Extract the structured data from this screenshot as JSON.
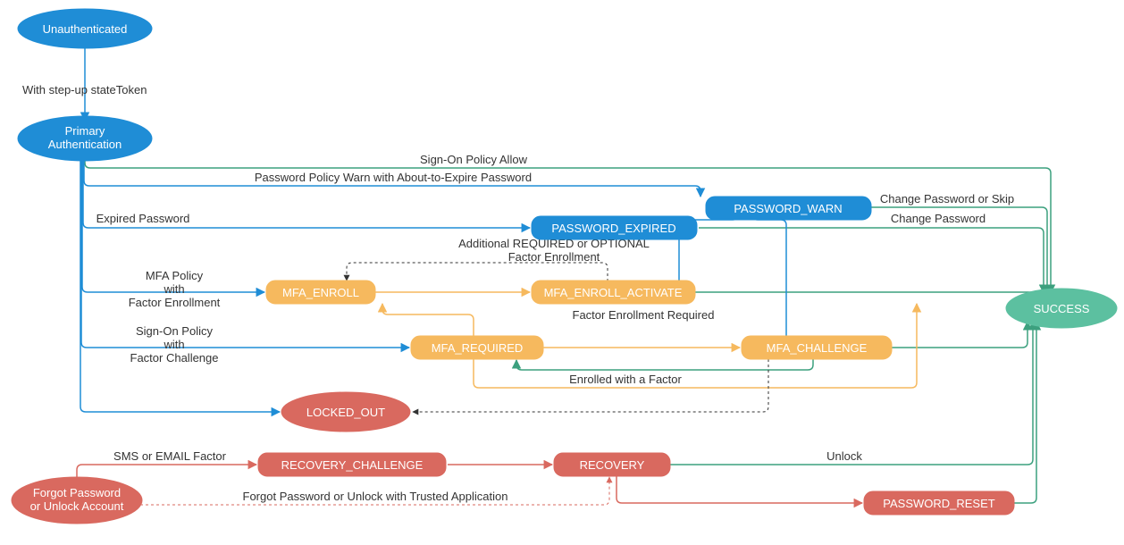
{
  "diagram": {
    "nodes": {
      "unauthenticated": "Unauthenticated",
      "primary_auth_l1": "Primary",
      "primary_auth_l2": "Authentication",
      "password_warn": "PASSWORD_WARN",
      "password_expired": "PASSWORD_EXPIRED",
      "mfa_enroll": "MFA_ENROLL",
      "mfa_enroll_activate": "MFA_ENROLL_ACTIVATE",
      "mfa_required": "MFA_REQUIRED",
      "mfa_challenge": "MFA_CHALLENGE",
      "locked_out": "LOCKED_OUT",
      "recovery_challenge": "RECOVERY_CHALLENGE",
      "recovery": "RECOVERY",
      "password_reset": "PASSWORD_RESET",
      "success": "SUCCESS",
      "forgot_l1": "Forgot Password",
      "forgot_l2": "or Unlock Account"
    },
    "edges": {
      "step_up": "With step-up stateToken",
      "signon_allow": "Sign-On Policy Allow",
      "pwd_warn": "Password Policy Warn with About-to-Expire Password",
      "change_or_skip": "Change Password or Skip",
      "expired_pwd": "Expired Password",
      "change_pwd": "Change Password",
      "mfa_policy_l1": "MFA Policy",
      "mfa_policy_l2": "with",
      "mfa_policy_l3": "Factor Enrollment",
      "signon_policy_l1": "Sign-On Policy",
      "signon_policy_l2": "with",
      "signon_policy_l3": "Factor Challenge",
      "additional_l1": "Additional REQUIRED or OPTIONAL",
      "additional_l2": "Factor Enrollment",
      "factor_enroll_req": "Factor Enrollment Required",
      "enrolled_factor": "Enrolled with a Factor",
      "sms_email": "SMS or EMAIL Factor",
      "unlock": "Unlock",
      "forgot_trusted": "Forgot Password or Unlock with Trusted Application"
    },
    "colors": {
      "blue": "#1f8dd6",
      "green_node": "#5cc0a0",
      "green_line": "#3ca07e",
      "orange": "#f6b95e",
      "red": "#d9695f"
    }
  }
}
